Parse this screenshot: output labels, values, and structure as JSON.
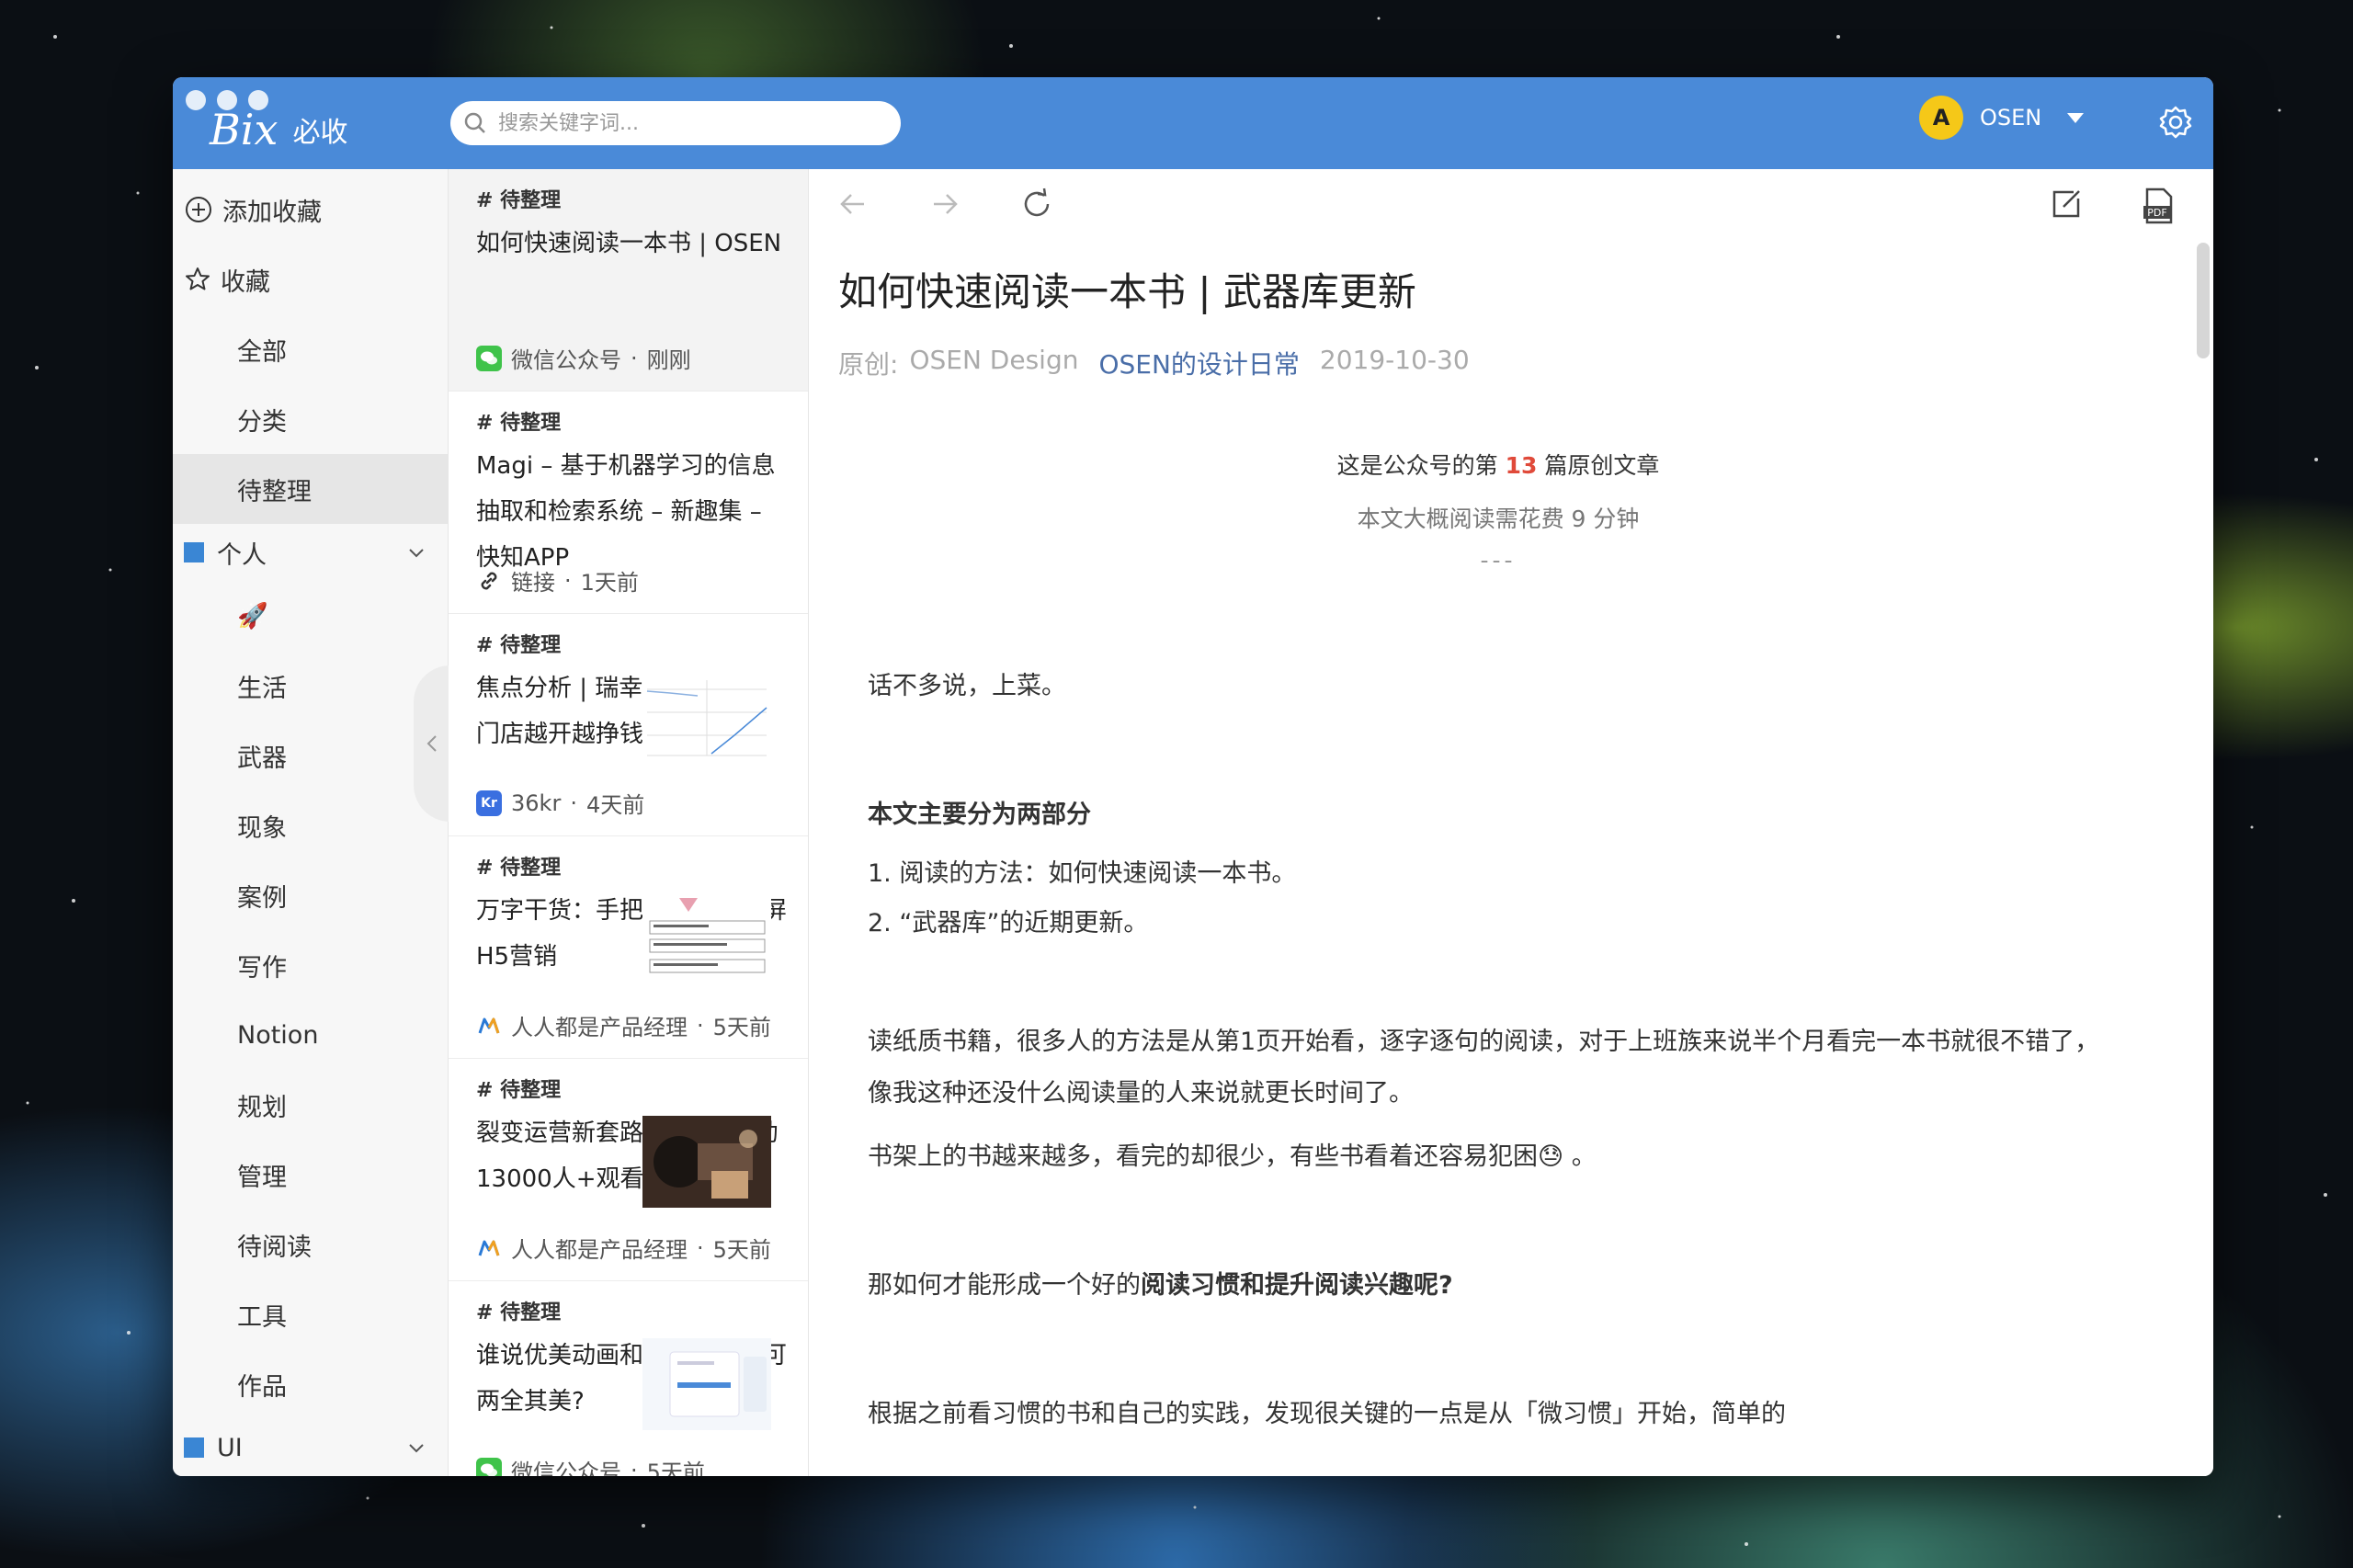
{
  "app": {
    "logo_mark": "Bix",
    "logo_text": "必收",
    "search_placeholder": "搜索关键字词...",
    "user_name": "OSEN",
    "user_avatar_letter": "A",
    "accent_color": "#4a8ad8"
  },
  "sidebar": {
    "add_label": "添加收藏",
    "fav_label": "收藏",
    "fav_items": [
      "全部",
      "分类",
      "待整理"
    ],
    "group_personal": "个人",
    "personal_items": [
      "🚀",
      "生活",
      "武器",
      "现象",
      "案例",
      "写作",
      "Notion",
      "规划",
      "管理",
      "待阅读",
      "工具",
      "作品"
    ],
    "group_ui": "UI"
  },
  "list": [
    {
      "tag": "# 待整理",
      "title": "如何快速阅读一本书 | OSEN",
      "source": "微信公众号",
      "time": "刚刚",
      "icon": "wechat-icon"
    },
    {
      "tag": "# 待整理",
      "title": "Magi – 基于机器学习的信息抽取和检索系统 – 新趣集 – 快知APP",
      "source": "链接",
      "time": "1天前",
      "icon": "link-icon"
    },
    {
      "tag": "# 待整理",
      "title": "焦点分析 | 瑞幸实现诺言，门店越开越挣钱",
      "source": "36kr",
      "time": "4天前",
      "icon": "36kr-icon"
    },
    {
      "tag": "# 待整理",
      "title": "万字干货：手把手教你做刷屏H5营销",
      "source": "人人都是产品经理",
      "time": "5天前",
      "icon": "woshipm-icon"
    },
    {
      "tag": "# 待整理",
      "title": "裂变运营新套路：0粉丝撬动13000人+观看直播",
      "source": "人人都是产品经理",
      "time": "5天前",
      "icon": "woshipm-icon"
    },
    {
      "tag": "# 待整理",
      "title": "谁说优美动画和高效性能不可两全其美?",
      "source": "微信公众号",
      "time": "5天前",
      "icon": "wechat-icon"
    }
  ],
  "article": {
    "title": "如何快速阅读一本书 | 武器库更新",
    "origin_label": "原创:",
    "author": "OSEN Design",
    "account": "OSEN的设计日常",
    "date": "2019-10-30",
    "intro_prefix": "这是公众号的第",
    "intro_num": "13",
    "intro_suffix": "篇原创文章",
    "read_time": "本文大概阅读需花费 9 分钟",
    "divider": "---",
    "p1": "话不多说，上菜。",
    "h1": "本文主要分为两部分",
    "li1": "1. 阅读的方法：如何快速阅读一本书。",
    "li2": "2. “武器库”的近期更新。",
    "p2": "读纸质书籍，很多人的方法是从第1页开始看，逐字逐句的阅读，对于上班族来说半个月看完一本书就很不错了，像我这种还没什么阅读量的人来说就更长时间了。",
    "p3": "书架上的书越来越多，看完的却很少，有些书看着还容易犯困😓 。",
    "p4_prefix": "那如何才能形成一个好的",
    "p4_bold": "阅读习惯和提升阅读兴趣呢?",
    "p5": "根据之前看习惯的书和自己的实践，发现很关键的一点是从「微习惯」开始，简单的"
  }
}
